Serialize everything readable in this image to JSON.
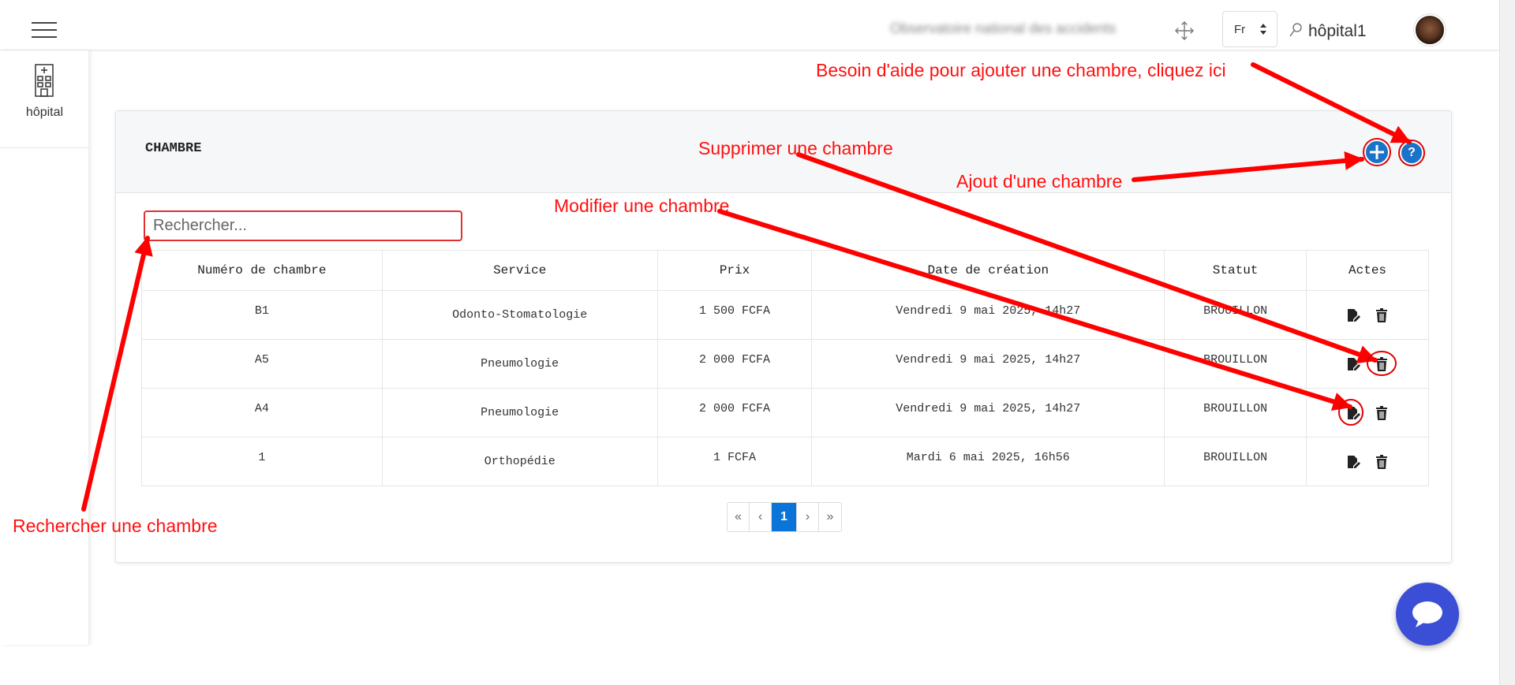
{
  "topbar": {
    "org_name": "Observatoire national des accidents",
    "language": "Fr",
    "user_name": "hôpital1"
  },
  "sidebar": {
    "items": [
      {
        "label": "hôpital",
        "icon": "hospital-building-icon"
      }
    ]
  },
  "card": {
    "title": "CHAMBRE",
    "add_icon": "plus-icon",
    "help_label": "?"
  },
  "search": {
    "placeholder": "Rechercher..."
  },
  "table": {
    "headers": [
      "Numéro de chambre",
      "Service",
      "Prix",
      "Date de création",
      "Statut",
      "Actes"
    ],
    "rows": [
      {
        "numero": "B1",
        "service": "Odonto-Stomatologie",
        "prix": "1 500 FCFA",
        "date": "Vendredi 9 mai 2025, 14h27",
        "statut": "BROUILLON"
      },
      {
        "numero": "A5",
        "service": "Pneumologie",
        "prix": "2 000 FCFA",
        "date": "Vendredi 9 mai 2025, 14h27",
        "statut": "BROUILLON"
      },
      {
        "numero": "A4",
        "service": "Pneumologie",
        "prix": "2 000 FCFA",
        "date": "Vendredi 9 mai 2025, 14h27",
        "statut": "BROUILLON"
      },
      {
        "numero": "1",
        "service": "Orthopédie",
        "prix": "1 FCFA",
        "date": "Mardi 6 mai 2025, 16h56",
        "statut": "BROUILLON"
      }
    ],
    "action_icons": [
      "edit-document-icon",
      "trash-icon"
    ]
  },
  "pagination": {
    "first": "«",
    "prev": "‹",
    "current": "1",
    "next": "›",
    "last": "»"
  },
  "annotations": {
    "help": "Besoin d'aide pour ajouter une chambre, cliquez ici",
    "delete": "Supprimer une chambre",
    "add": "Ajout d'une chambre",
    "edit": "Modifier une chambre",
    "search": "Rechercher une chambre"
  },
  "colors": {
    "accent": "#0b74d8",
    "annotation": "#ff1010",
    "chat": "#3a4fd6"
  }
}
